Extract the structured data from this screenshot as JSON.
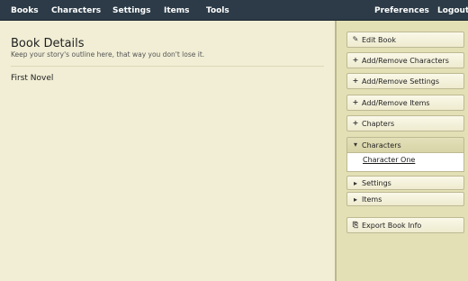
{
  "nav": {
    "left": [
      {
        "label": "Books"
      },
      {
        "label": "Characters"
      },
      {
        "label": "Settings"
      },
      {
        "label": "Items"
      },
      {
        "label": "Tools"
      }
    ],
    "right": [
      {
        "label": "Preferences"
      },
      {
        "label": "Logout"
      }
    ]
  },
  "main": {
    "title": "Book Details",
    "subtitle": "Keep your story's outline here, that way you don't lose it.",
    "book_name": "First Novel"
  },
  "sidebar": {
    "edit_book": {
      "label": "Edit Book",
      "icon": "pencil-icon"
    },
    "add_remove_characters": {
      "label": "Add/Remove Characters",
      "icon": "plus-icon"
    },
    "add_remove_settings": {
      "label": "Add/Remove Settings",
      "icon": "plus-icon"
    },
    "add_remove_items": {
      "label": "Add/Remove Items",
      "icon": "plus-icon"
    },
    "chapters": {
      "label": "Chapters",
      "icon": "plus-icon"
    },
    "characters_section": {
      "label": "Characters",
      "icon": "triangle-down-icon",
      "items": [
        {
          "label": "Character One"
        }
      ]
    },
    "settings_section": {
      "label": "Settings",
      "icon": "triangle-right-icon"
    },
    "items_section": {
      "label": "Items",
      "icon": "triangle-right-icon"
    },
    "export_book_info": {
      "label": "Export Book Info",
      "icon": "export-icon"
    }
  },
  "colors": {
    "nav_bg": "#2c3b47",
    "main_bg": "#f1eed5",
    "sidebar_bg": "#e4e0b6",
    "button_border": "#bdb993"
  }
}
